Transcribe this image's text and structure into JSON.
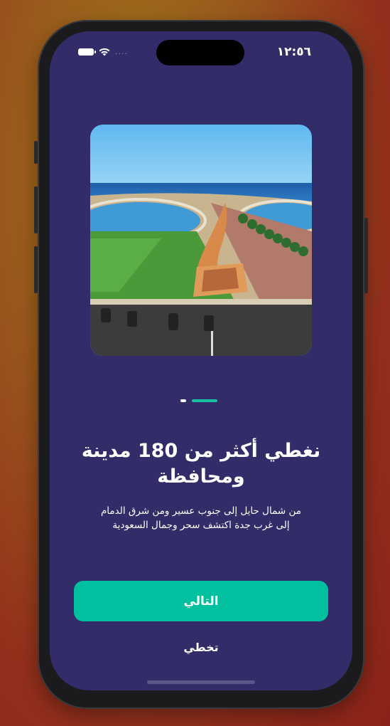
{
  "status_bar": {
    "time": "١٢:٥٦",
    "signal": "....",
    "battery_icon": "battery-icon",
    "wifi_icon": "wifi-icon"
  },
  "onboarding": {
    "image_description_icon": "city-waterfront-photo",
    "page_index": 2,
    "page_count": 2,
    "title": "نغطي أكثر من 180 مدينة ومحافظة",
    "subtitle_line1": "من شمال حايل إلى جنوب عسير ومن شرق الدمام",
    "subtitle_line2": "إلى غرب جدة اكتشف سحر وجمال السعودية"
  },
  "actions": {
    "next_label": "التالي",
    "skip_label": "تخطي"
  },
  "colors": {
    "screen_background": "#322c69",
    "accent": "#00c09f",
    "text": "#ffffff"
  }
}
